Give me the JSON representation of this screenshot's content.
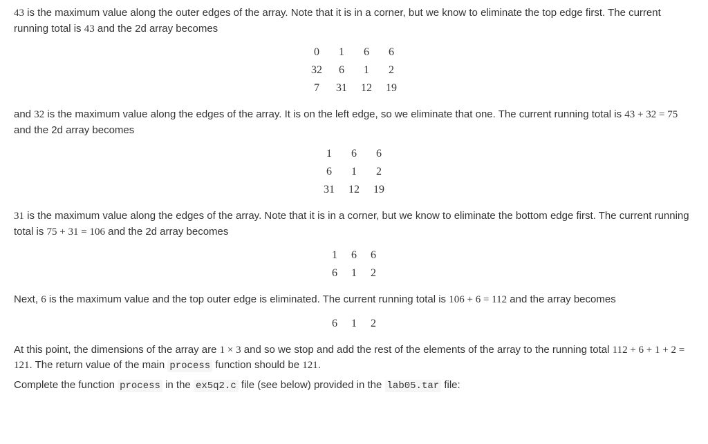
{
  "para1_a": "43",
  "para1_b": " is the maximum value along the outer edges of the array. Note that it is in a corner, but we know to eliminate the top edge first. The current running total is ",
  "para1_c": "43",
  "para1_d": " and the 2d array becomes",
  "matrix1": [
    [
      "0",
      "1",
      "6",
      "6"
    ],
    [
      "32",
      "6",
      "1",
      "2"
    ],
    [
      "7",
      "31",
      "12",
      "19"
    ]
  ],
  "para2_a": "and ",
  "para2_b": "32",
  "para2_c": " is the maximum value along the edges of the array. It is on the left edge, so we eliminate that one. The current running total is ",
  "para2_d": "43 + 32 = 75",
  "para2_e": " and the 2d array becomes",
  "matrix2": [
    [
      "1",
      "6",
      "6"
    ],
    [
      "6",
      "1",
      "2"
    ],
    [
      "31",
      "12",
      "19"
    ]
  ],
  "para3_a": "31",
  "para3_b": " is the maximum value along the edges of the array. Note that it is in a corner, but we know to eliminate the bottom edge first. The current running total is ",
  "para3_c": "75 + 31 = 106",
  "para3_d": " and the 2d array becomes",
  "matrix3": [
    [
      "1",
      "6",
      "6"
    ],
    [
      "6",
      "1",
      "2"
    ]
  ],
  "para4_a": "Next, ",
  "para4_b": "6",
  "para4_c": " is the maximum value and the top outer edge is eliminated. The current running total is ",
  "para4_d": "106 + 6 = 112",
  "para4_e": " and the array becomes",
  "matrix4": [
    [
      "6",
      "1",
      "2"
    ]
  ],
  "para5_a": "At this point, the dimensions of the array are ",
  "para5_b": "1 × 3",
  "para5_c": " and so we stop and add the rest of the elements of the array to the running total ",
  "para5_d": "112 + 6 + 1 + 2 = 121",
  "para5_e": ". The return value of the main ",
  "para5_code1": "process",
  "para5_f": " function should be ",
  "para5_g": "121",
  "para5_h": ".",
  "para6_a": "Complete the function ",
  "para6_code1": "process",
  "para6_b": " in the ",
  "para6_code2": "ex5q2.c",
  "para6_c": " file (see below) provided in the ",
  "para6_code3": "lab05.tar",
  "para6_d": " file:"
}
